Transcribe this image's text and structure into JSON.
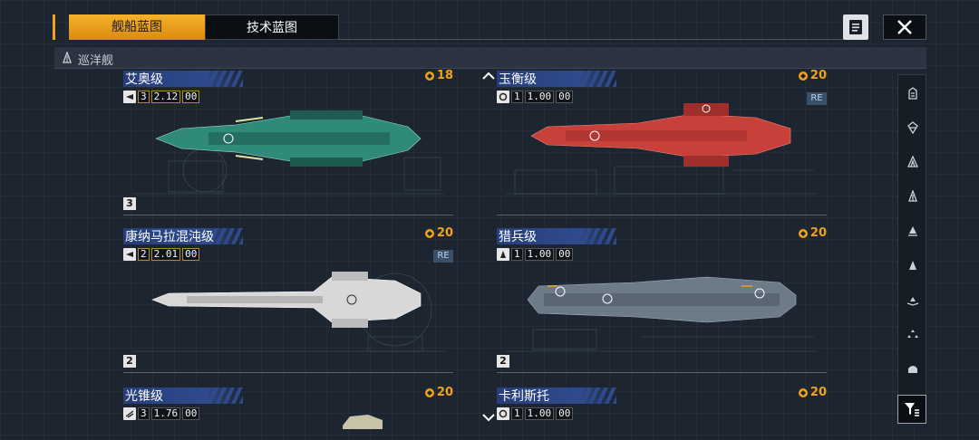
{
  "tabs": {
    "ship": "舰船蓝图",
    "tech": "技术蓝图"
  },
  "category": {
    "label": "巡洋舰",
    "icon": "cruiser-icon"
  },
  "cards": [
    {
      "name": "艾奥级",
      "cost": "18",
      "type_icon": "ship-type-icon",
      "count": "3",
      "value": "2.12",
      "unit": "00",
      "tier": "3",
      "re": false,
      "color": "#2f8a7a"
    },
    {
      "name": "玉衡级",
      "cost": "20",
      "type_icon": "ship-type-icon",
      "count": "1",
      "value": "1.00",
      "unit": "00",
      "tier": "",
      "re": true,
      "re_label": "RE",
      "color": "#c8403a"
    },
    {
      "name": "康纳马拉混沌级",
      "cost": "20",
      "type_icon": "ship-type-icon",
      "count": "2",
      "value": "2.01",
      "unit": "00",
      "tier": "2",
      "re": true,
      "re_label": "RE",
      "color": "#d8d8d8"
    },
    {
      "name": "猎兵级",
      "cost": "20",
      "type_icon": "ship-type-icon",
      "count": "1",
      "value": "1.00",
      "unit": "00",
      "tier": "2",
      "re": false,
      "color": "#6d7a88"
    },
    {
      "name": "光锥级",
      "cost": "20",
      "type_icon": "ship-type-icon",
      "count": "3",
      "value": "1.76",
      "unit": "00",
      "tier": "",
      "re": false,
      "color": "#c8c2a8"
    },
    {
      "name": "卡利斯托",
      "cost": "20",
      "type_icon": "ship-type-icon",
      "count": "1",
      "value": "1.00",
      "unit": "00",
      "tier": "",
      "re": false,
      "color": "#6d7a88"
    }
  ],
  "rail": [
    "carrier-icon",
    "battleship-icon",
    "battlecruiser-icon",
    "cruiser-icon",
    "destroyer-icon",
    "frigate-icon",
    "corvette-icon",
    "fighter-icon",
    "support-icon"
  ],
  "colors": {
    "accent": "#f0a21a",
    "title_band": "#2f4a8d"
  }
}
